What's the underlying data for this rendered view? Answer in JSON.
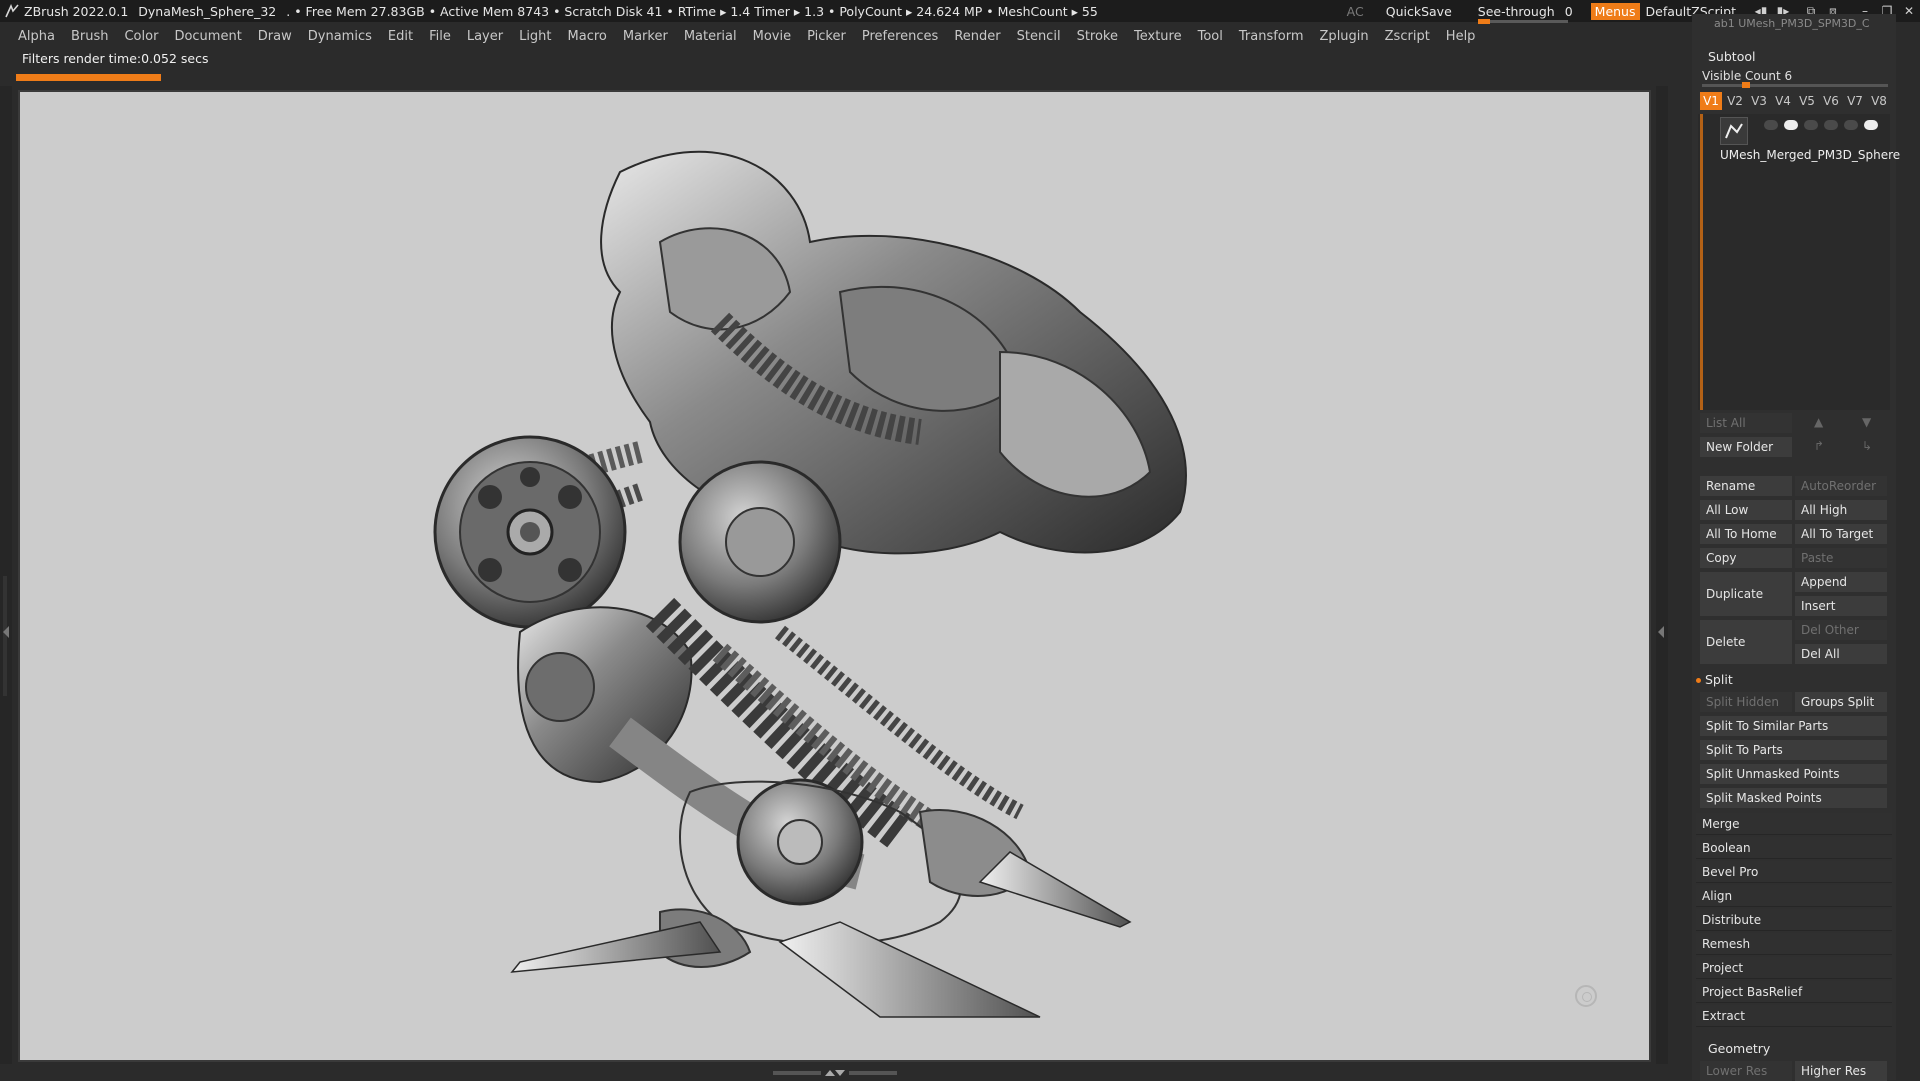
{
  "titlebar": {
    "app": "ZBrush 2022.0.1",
    "document": "DynaMesh_Sphere_32",
    "stats": ". • Free Mem 27.83GB • Active Mem 8743 • Scratch Disk 41 •  RTime ▸ 1.4 Timer ▸ 1.3 • PolyCount ▸ 24.624 MP  • MeshCount ▸ 55",
    "ac": "AC",
    "quicksave": "QuickSave",
    "seethrough_label": "See-through",
    "seethrough_value": "0",
    "menus": "Menus",
    "default_script": "DefaultZScript",
    "seethrough_level": 0
  },
  "menubar": [
    "Alpha",
    "Brush",
    "Color",
    "Document",
    "Draw",
    "Dynamics",
    "Edit",
    "File",
    "Layer",
    "Light",
    "Macro",
    "Marker",
    "Material",
    "Movie",
    "Picker",
    "Preferences",
    "Render",
    "Stencil",
    "Stroke",
    "Texture",
    "Tool",
    "Transform",
    "Zplugin",
    "Zscript",
    "Help"
  ],
  "notice": "Filters render time:0.052 secs",
  "panel": {
    "ghost_header": "ab1   UMesh_PM3D_SPM3D_C",
    "subtool_title": "Subtool",
    "visible_count": "Visible Count 6",
    "vtabs": [
      "V1",
      "V2",
      "V3",
      "V4",
      "V5",
      "V6",
      "V7",
      "V8"
    ],
    "active_vtab": "V1",
    "subtool_name": "UMesh_Merged_PM3D_Sphere",
    "list_all": "List All",
    "new_folder": "New Folder",
    "rename": "Rename",
    "autoreorder": "AutoReorder",
    "all_low": "All Low",
    "all_high": "All High",
    "all_to_home": "All To Home",
    "all_to_target": "All To Target",
    "copy": "Copy",
    "paste": "Paste",
    "duplicate": "Duplicate",
    "append": "Append",
    "insert": "Insert",
    "delete": "Delete",
    "del_other": "Del Other",
    "del_all": "Del All",
    "split_title": "Split",
    "split_hidden": "Split Hidden",
    "groups_split": "Groups Split",
    "split_similar": "Split To Similar Parts",
    "split_parts": "Split To Parts",
    "split_unmasked": "Split Unmasked Points",
    "split_masked": "Split Masked Points",
    "subpanels": [
      "Merge",
      "Boolean",
      "Bevel Pro",
      "Align",
      "Distribute",
      "Remesh",
      "Project",
      "Project BasRelief",
      "Extract"
    ],
    "geometry_title": "Geometry",
    "lower_res": "Lower Res",
    "higher_res": "Higher Res"
  }
}
